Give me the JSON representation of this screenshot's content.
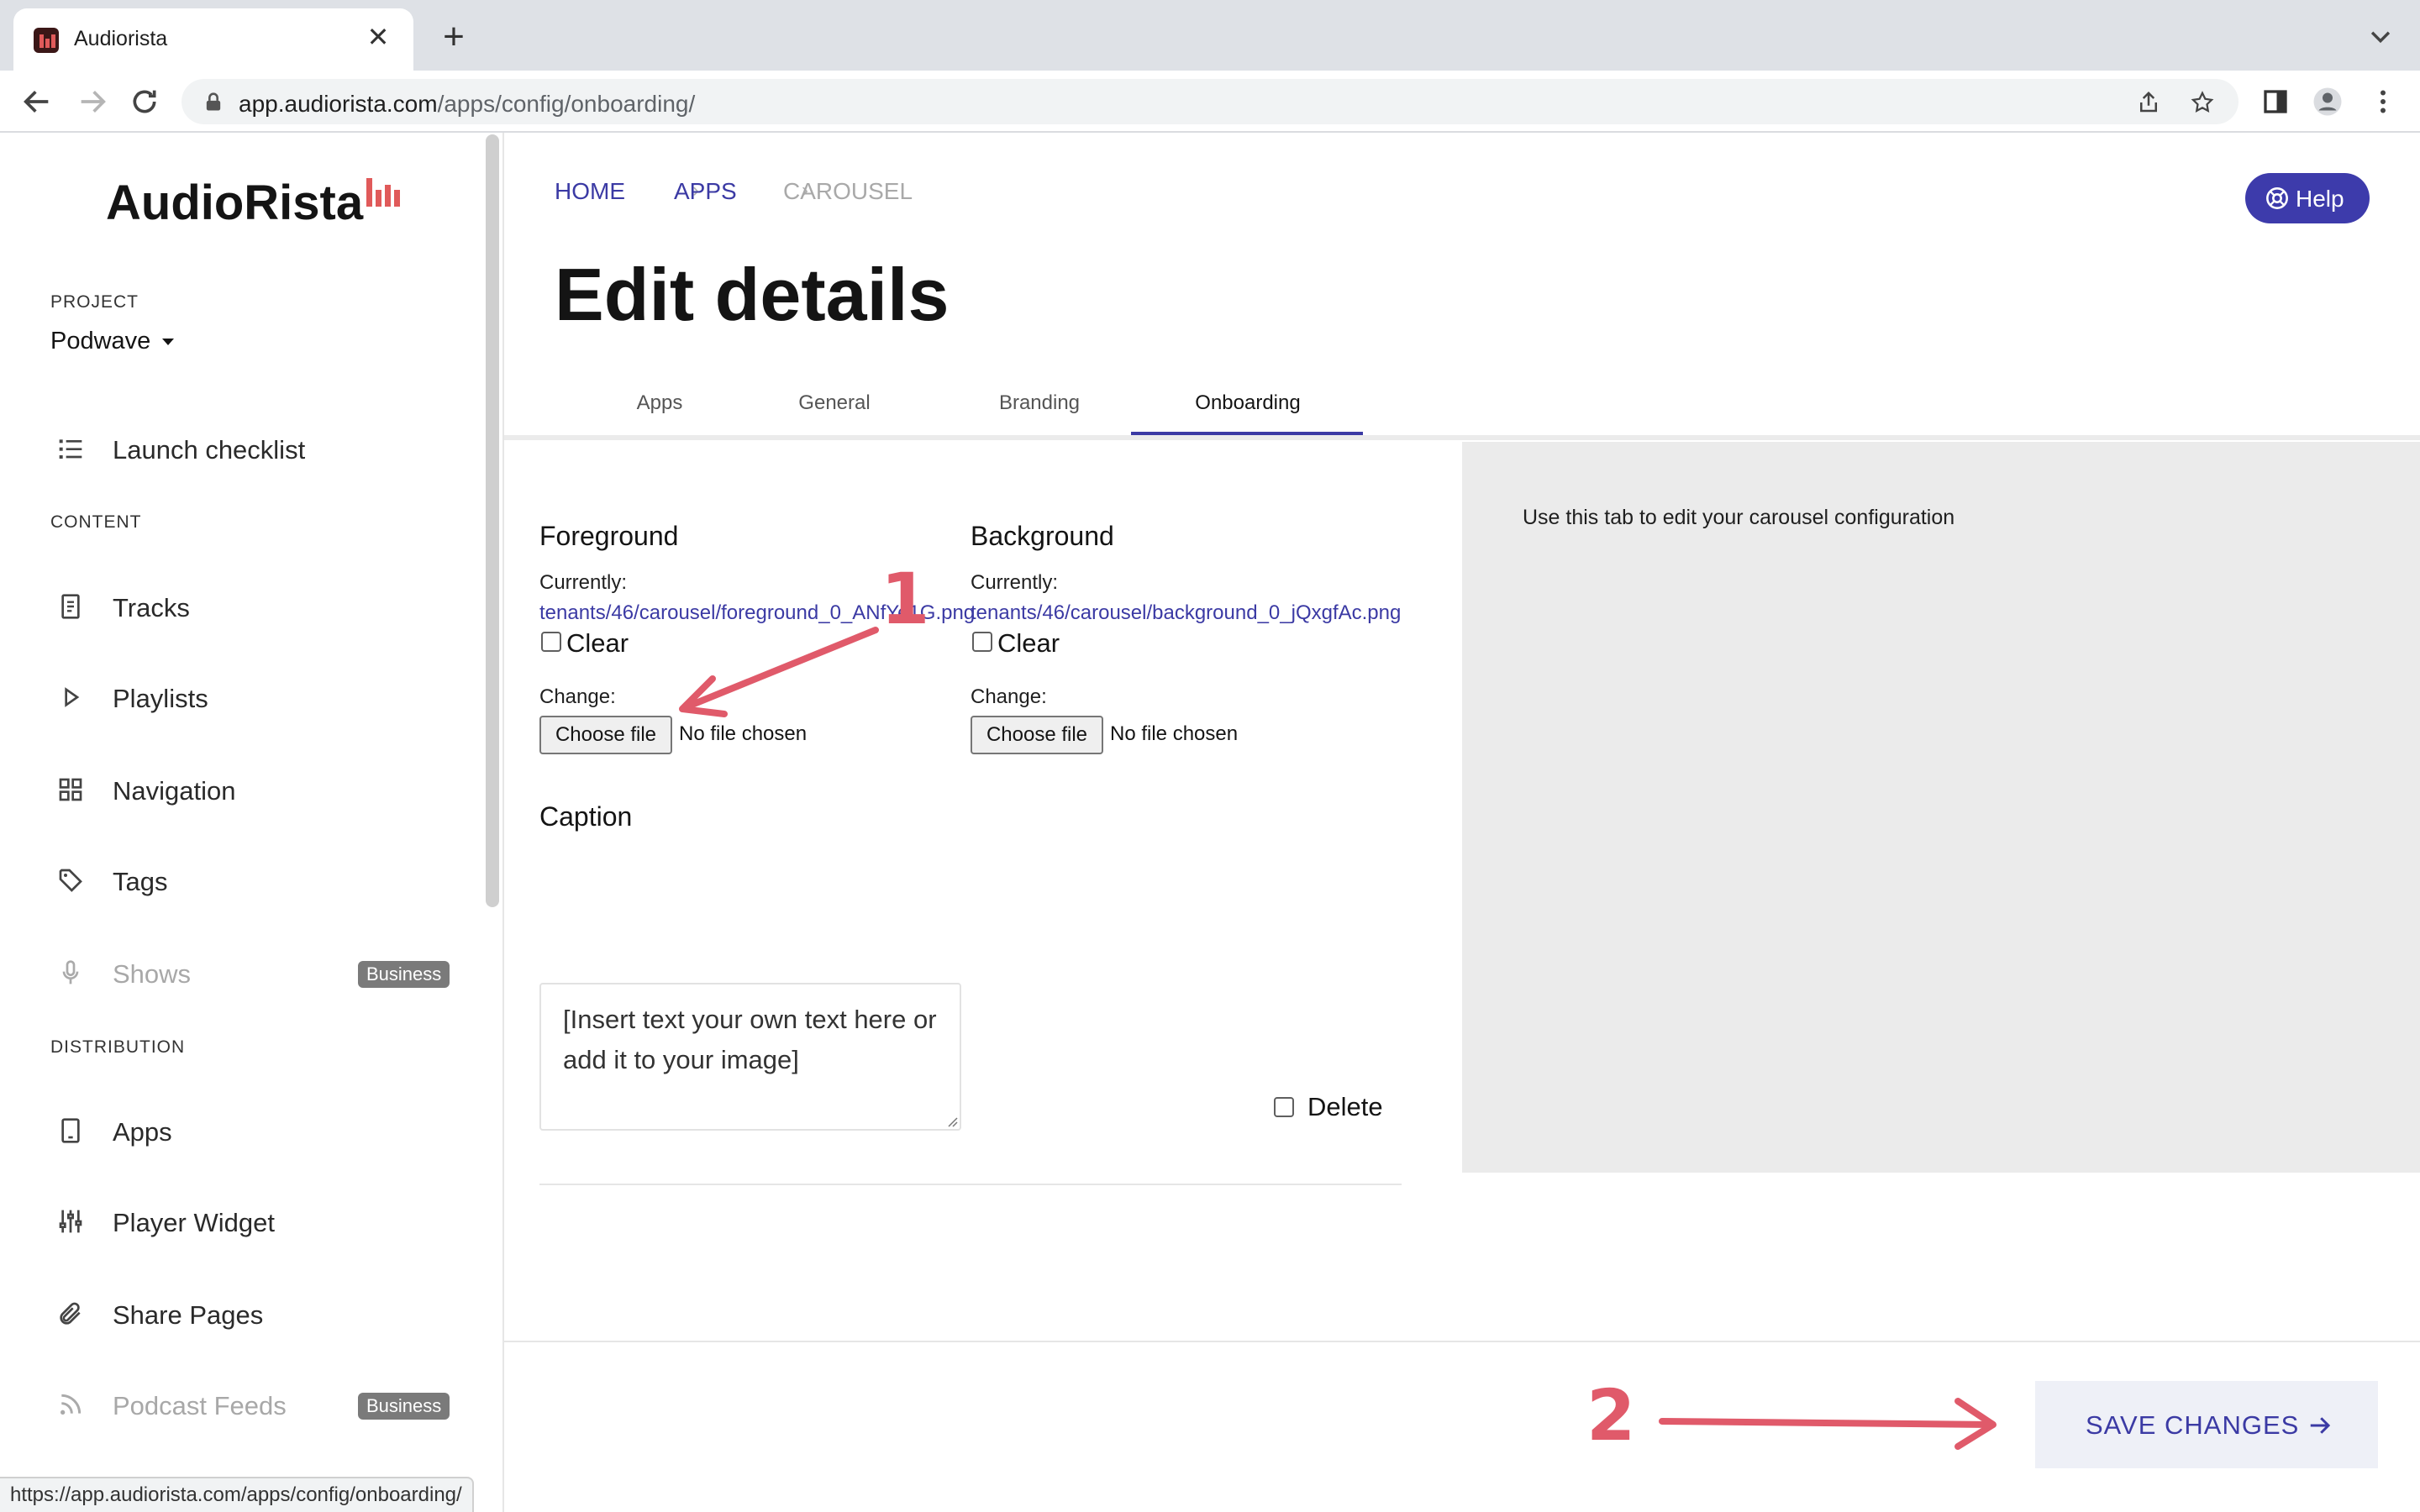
{
  "browser": {
    "tab_title": "Audiorista",
    "new_tab_symbol": "+",
    "close_symbol": "✕",
    "url_host": "app.audiorista.com",
    "url_path": "/apps/config/onboarding/",
    "status_url": "https://app.audiorista.com/apps/config/onboarding/"
  },
  "sidebar": {
    "logo": "AudioRista",
    "project_label": "PROJECT",
    "project_name": "Podwave",
    "launch_checklist": "Launch checklist",
    "content_label": "CONTENT",
    "distribution_label": "DISTRIBUTION",
    "items": [
      {
        "label": "Tracks",
        "icon": "document-icon"
      },
      {
        "label": "Playlists",
        "icon": "play-icon"
      },
      {
        "label": "Navigation",
        "icon": "grid-icon"
      },
      {
        "label": "Tags",
        "icon": "tag-icon"
      },
      {
        "label": "Shows",
        "icon": "microphone-icon",
        "badge": "Business"
      },
      {
        "label": "Apps",
        "icon": "tablet-icon"
      },
      {
        "label": "Player Widget",
        "icon": "sliders-icon"
      },
      {
        "label": "Share Pages",
        "icon": "paperclip-icon"
      },
      {
        "label": "Podcast Feeds",
        "icon": "rss-icon",
        "badge": "Business"
      }
    ]
  },
  "breadcrumb": {
    "home": "HOME",
    "apps": "APPS",
    "current": "CAROUSEL",
    "separator": "›"
  },
  "help_label": "Help",
  "page_title": "Edit details",
  "tabs": [
    "Apps",
    "General",
    "Branding",
    "Onboarding"
  ],
  "active_tab": "Onboarding",
  "form": {
    "foreground": {
      "title": "Foreground",
      "currently_label": "Currently:",
      "file": "tenants/46/carousel/foreground_0_ANfYe1G.png",
      "clear_label": "Clear",
      "change_label": "Change:",
      "choose_label": "Choose file",
      "no_file": "No file chosen"
    },
    "background": {
      "title": "Background",
      "currently_label": "Currently:",
      "file": "tenants/46/carousel/background_0_jQxgfAc.png",
      "clear_label": "Clear",
      "change_label": "Change:",
      "choose_label": "Choose file",
      "no_file": "No file chosen"
    },
    "caption_title": "Caption",
    "caption_value": "[Insert text your own text here or add it to your image]",
    "delete_label": "Delete"
  },
  "info_text": "Use this tab to edit your carousel configuration",
  "save_label": "SAVE CHANGES",
  "annotations": {
    "step1": "1",
    "step2": "2",
    "color": "#e05a6a"
  },
  "colors": {
    "accent": "#3b3aa4",
    "brand_red": "#e05a5a",
    "info_bg": "#ebebeb"
  }
}
